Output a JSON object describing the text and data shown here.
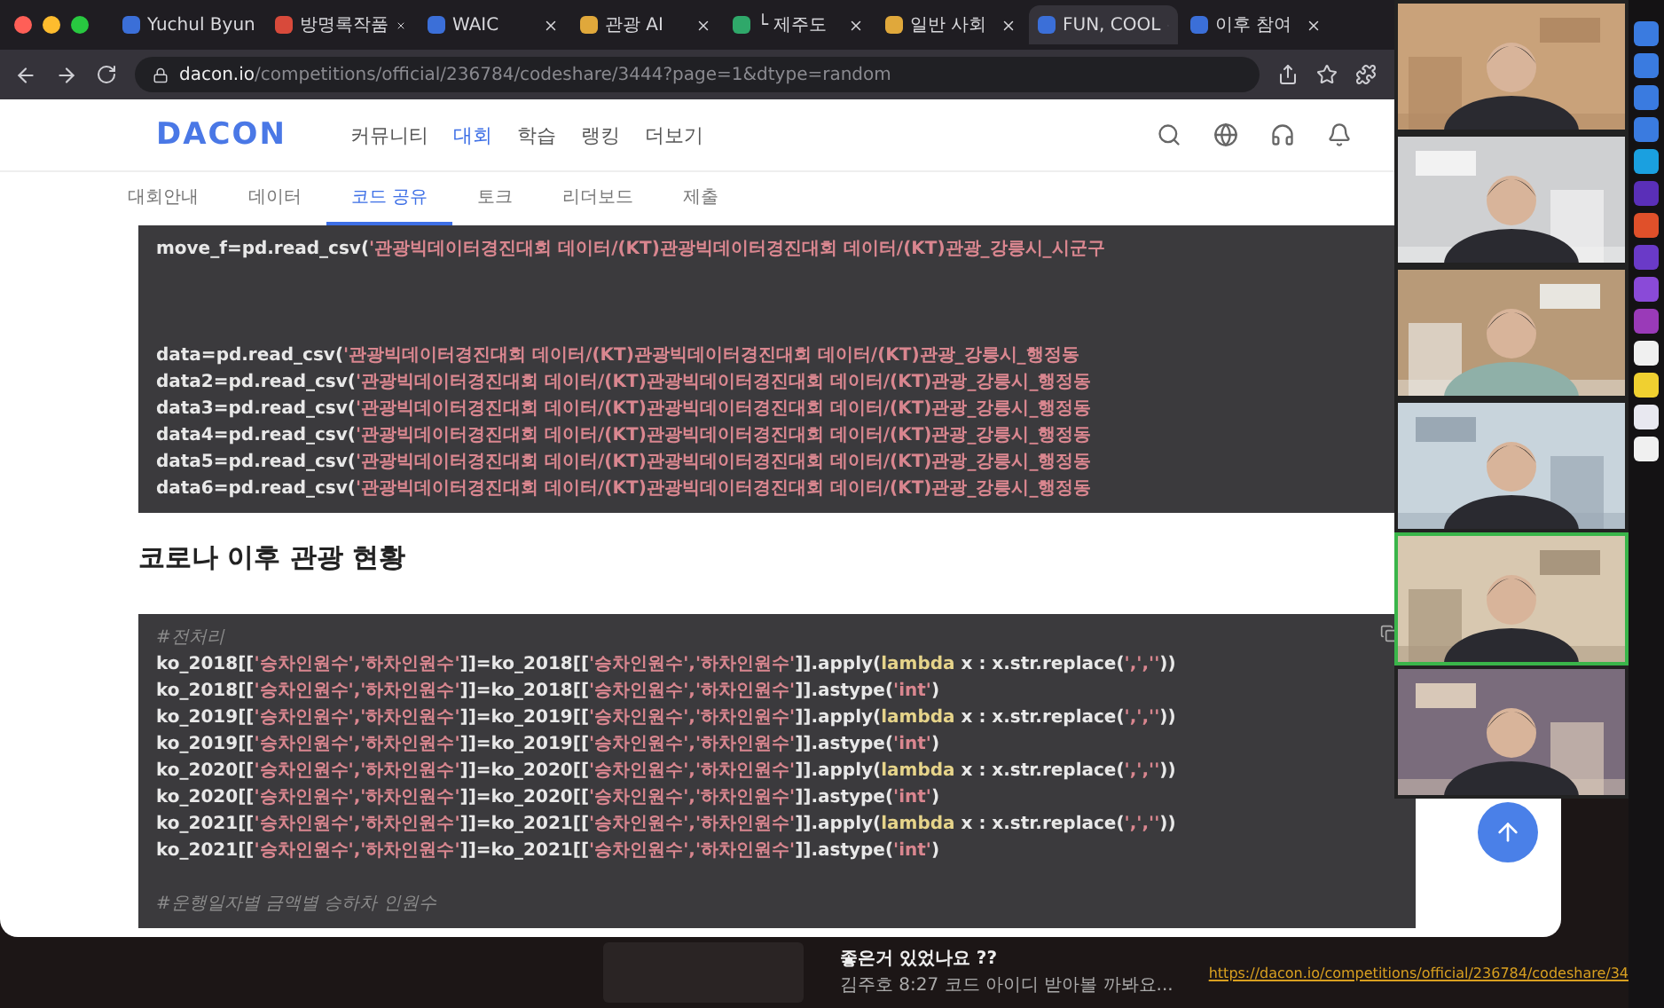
{
  "browser": {
    "tabs": [
      {
        "label": "Yuchul Byun",
        "selected": false,
        "color": "#3b6fd8"
      },
      {
        "label": "방명록작품",
        "selected": false,
        "color": "#d84a3b"
      },
      {
        "label": "WAIC",
        "selected": false,
        "color": "#3b6fd8"
      },
      {
        "label": "관광 AI",
        "selected": false,
        "color": "#e0a83b"
      },
      {
        "label": "└ 제주도",
        "selected": false,
        "color": "#2fa86a"
      },
      {
        "label": "일반 사회",
        "selected": false,
        "color": "#e0a83b"
      },
      {
        "label": "FUN, COOL",
        "selected": true,
        "color": "#3b6fd8"
      },
      {
        "label": "이후 참여",
        "selected": false,
        "color": "#3b6fd8"
      }
    ],
    "url_host": "dacon.io",
    "url_path": "/competitions/official/236784/codeshare/3444?page=1&dtype=random"
  },
  "site": {
    "logo": "DACON",
    "nav": [
      {
        "label": "커뮤니티",
        "selected": false
      },
      {
        "label": "대회",
        "selected": true
      },
      {
        "label": "학습",
        "selected": false
      },
      {
        "label": "랭킹",
        "selected": false
      },
      {
        "label": "더보기",
        "selected": false
      }
    ],
    "subtabs": [
      {
        "label": "대회안내",
        "selected": false
      },
      {
        "label": "데이터",
        "selected": false
      },
      {
        "label": "코드 공유",
        "selected": true
      },
      {
        "label": "토크",
        "selected": false
      },
      {
        "label": "리더보드",
        "selected": false
      },
      {
        "label": "제출",
        "selected": false
      }
    ]
  },
  "code_block_1": [
    {
      "kind": "code",
      "tokens": [
        {
          "kind": "plain",
          "text": "move_f=pd.read_csv("
        },
        {
          "kind": "str",
          "text": "'관광빅데이터경진대회 데이터/(KT)관광빅데이터경진대회 데이터/(KT)관광_강릉시_시군구"
        }
      ]
    },
    {
      "kind": "blank"
    },
    {
      "kind": "blank"
    },
    {
      "kind": "blank"
    },
    {
      "kind": "code",
      "tokens": [
        {
          "kind": "plain",
          "text": "data=pd.read_csv("
        },
        {
          "kind": "str",
          "text": "'관광빅데이터경진대회 데이터/(KT)관광빅데이터경진대회 데이터/(KT)관광_강릉시_행정동"
        }
      ]
    },
    {
      "kind": "code",
      "tokens": [
        {
          "kind": "plain",
          "text": "data2=pd.read_csv("
        },
        {
          "kind": "str",
          "text": "'관광빅데이터경진대회 데이터/(KT)관광빅데이터경진대회 데이터/(KT)관광_강릉시_행정동"
        }
      ]
    },
    {
      "kind": "code",
      "tokens": [
        {
          "kind": "plain",
          "text": "data3=pd.read_csv("
        },
        {
          "kind": "str",
          "text": "'관광빅데이터경진대회 데이터/(KT)관광빅데이터경진대회 데이터/(KT)관광_강릉시_행정동"
        }
      ]
    },
    {
      "kind": "code",
      "tokens": [
        {
          "kind": "plain",
          "text": "data4=pd.read_csv("
        },
        {
          "kind": "str",
          "text": "'관광빅데이터경진대회 데이터/(KT)관광빅데이터경진대회 데이터/(KT)관광_강릉시_행정동"
        }
      ]
    },
    {
      "kind": "code",
      "tokens": [
        {
          "kind": "plain",
          "text": "data5=pd.read_csv("
        },
        {
          "kind": "str",
          "text": "'관광빅데이터경진대회 데이터/(KT)관광빅데이터경진대회 데이터/(KT)관광_강릉시_행정동"
        }
      ]
    },
    {
      "kind": "code",
      "tokens": [
        {
          "kind": "plain",
          "text": "data6=pd.read_csv("
        },
        {
          "kind": "str",
          "text": "'관광빅데이터경진대회 데이터/(KT)관광빅데이터경진대회 데이터/(KT)관광_강릉시_행정동"
        }
      ]
    }
  ],
  "section_heading": "코로나 이후 관광 현황",
  "code_block_2": [
    {
      "kind": "comment",
      "tokens": [
        {
          "kind": "comment",
          "text": "#전처리"
        }
      ]
    },
    {
      "kind": "code",
      "tokens": [
        {
          "kind": "plain",
          "text": "ko_2018[["
        },
        {
          "kind": "str",
          "text": "'승차인원수','하차인원수'"
        },
        {
          "kind": "plain",
          "text": "]]=ko_2018[["
        },
        {
          "kind": "str",
          "text": "'승차인원수','하차인원수'"
        },
        {
          "kind": "plain",
          "text": "]].apply("
        },
        {
          "kind": "kw",
          "text": "lambda"
        },
        {
          "kind": "plain",
          "text": " x : x.str.replace("
        },
        {
          "kind": "str",
          "text": "',',''"
        },
        {
          "kind": "plain",
          "text": "))"
        }
      ]
    },
    {
      "kind": "code",
      "tokens": [
        {
          "kind": "plain",
          "text": "ko_2018[["
        },
        {
          "kind": "str",
          "text": "'승차인원수','하차인원수'"
        },
        {
          "kind": "plain",
          "text": "]]=ko_2018[["
        },
        {
          "kind": "str",
          "text": "'승차인원수','하차인원수'"
        },
        {
          "kind": "plain",
          "text": "]].astype("
        },
        {
          "kind": "str",
          "text": "'int'"
        },
        {
          "kind": "plain",
          "text": ")"
        }
      ]
    },
    {
      "kind": "code",
      "tokens": [
        {
          "kind": "plain",
          "text": "ko_2019[["
        },
        {
          "kind": "str",
          "text": "'승차인원수','하차인원수'"
        },
        {
          "kind": "plain",
          "text": "]]=ko_2019[["
        },
        {
          "kind": "str",
          "text": "'승차인원수','하차인원수'"
        },
        {
          "kind": "plain",
          "text": "]].apply("
        },
        {
          "kind": "kw",
          "text": "lambda"
        },
        {
          "kind": "plain",
          "text": " x : x.str.replace("
        },
        {
          "kind": "str",
          "text": "',',''"
        },
        {
          "kind": "plain",
          "text": "))"
        }
      ]
    },
    {
      "kind": "code",
      "tokens": [
        {
          "kind": "plain",
          "text": "ko_2019[["
        },
        {
          "kind": "str",
          "text": "'승차인원수','하차인원수'"
        },
        {
          "kind": "plain",
          "text": "]]=ko_2019[["
        },
        {
          "kind": "str",
          "text": "'승차인원수','하차인원수'"
        },
        {
          "kind": "plain",
          "text": "]].astype("
        },
        {
          "kind": "str",
          "text": "'int'"
        },
        {
          "kind": "plain",
          "text": ")"
        }
      ]
    },
    {
      "kind": "code",
      "tokens": [
        {
          "kind": "plain",
          "text": "ko_2020[["
        },
        {
          "kind": "str",
          "text": "'승차인원수','하차인원수'"
        },
        {
          "kind": "plain",
          "text": "]]=ko_2020[["
        },
        {
          "kind": "str",
          "text": "'승차인원수','하차인원수'"
        },
        {
          "kind": "plain",
          "text": "]].apply("
        },
        {
          "kind": "kw",
          "text": "lambda"
        },
        {
          "kind": "plain",
          "text": " x : x.str.replace("
        },
        {
          "kind": "str",
          "text": "',',''"
        },
        {
          "kind": "plain",
          "text": "))"
        }
      ]
    },
    {
      "kind": "code",
      "tokens": [
        {
          "kind": "plain",
          "text": "ko_2020[["
        },
        {
          "kind": "str",
          "text": "'승차인원수','하차인원수'"
        },
        {
          "kind": "plain",
          "text": "]]=ko_2020[["
        },
        {
          "kind": "str",
          "text": "'승차인원수','하차인원수'"
        },
        {
          "kind": "plain",
          "text": "]].astype("
        },
        {
          "kind": "str",
          "text": "'int'"
        },
        {
          "kind": "plain",
          "text": ")"
        }
      ]
    },
    {
      "kind": "code",
      "tokens": [
        {
          "kind": "plain",
          "text": "ko_2021[["
        },
        {
          "kind": "str",
          "text": "'승차인원수','하차인원수'"
        },
        {
          "kind": "plain",
          "text": "]]=ko_2021[["
        },
        {
          "kind": "str",
          "text": "'승차인원수','하차인원수'"
        },
        {
          "kind": "plain",
          "text": "]].apply("
        },
        {
          "kind": "kw",
          "text": "lambda"
        },
        {
          "kind": "plain",
          "text": " x : x.str.replace("
        },
        {
          "kind": "str",
          "text": "',',''"
        },
        {
          "kind": "plain",
          "text": "))"
        }
      ]
    },
    {
      "kind": "code",
      "tokens": [
        {
          "kind": "plain",
          "text": "ko_2021[["
        },
        {
          "kind": "str",
          "text": "'승차인원수','하차인원수'"
        },
        {
          "kind": "plain",
          "text": "]]=ko_2021[["
        },
        {
          "kind": "str",
          "text": "'승차인원수','하차인원수'"
        },
        {
          "kind": "plain",
          "text": "]].astype("
        },
        {
          "kind": "str",
          "text": "'int'"
        },
        {
          "kind": "plain",
          "text": ")"
        }
      ]
    },
    {
      "kind": "blank"
    },
    {
      "kind": "comment",
      "tokens": [
        {
          "kind": "comment",
          "text": "#운행일자별 금액별 승하차 인원수"
        }
      ]
    }
  ],
  "video_call": {
    "participants": [
      {
        "kind": "picture",
        "speaking": false
      },
      {
        "kind": "picture",
        "speaking": false
      },
      {
        "kind": "picture",
        "speaking": false
      },
      {
        "kind": "picture",
        "speaking": false
      },
      {
        "kind": "picture",
        "speaking": true
      },
      {
        "kind": "picture",
        "speaking": false
      }
    ]
  },
  "chat": {
    "message": "좋은거 있었나요 ??",
    "sender": "김주호 8:27",
    "preview": "코드 아이디 받아볼 까봐요...",
    "link": "https://dacon.io/competitions/official/236784/codeshare/34"
  }
}
